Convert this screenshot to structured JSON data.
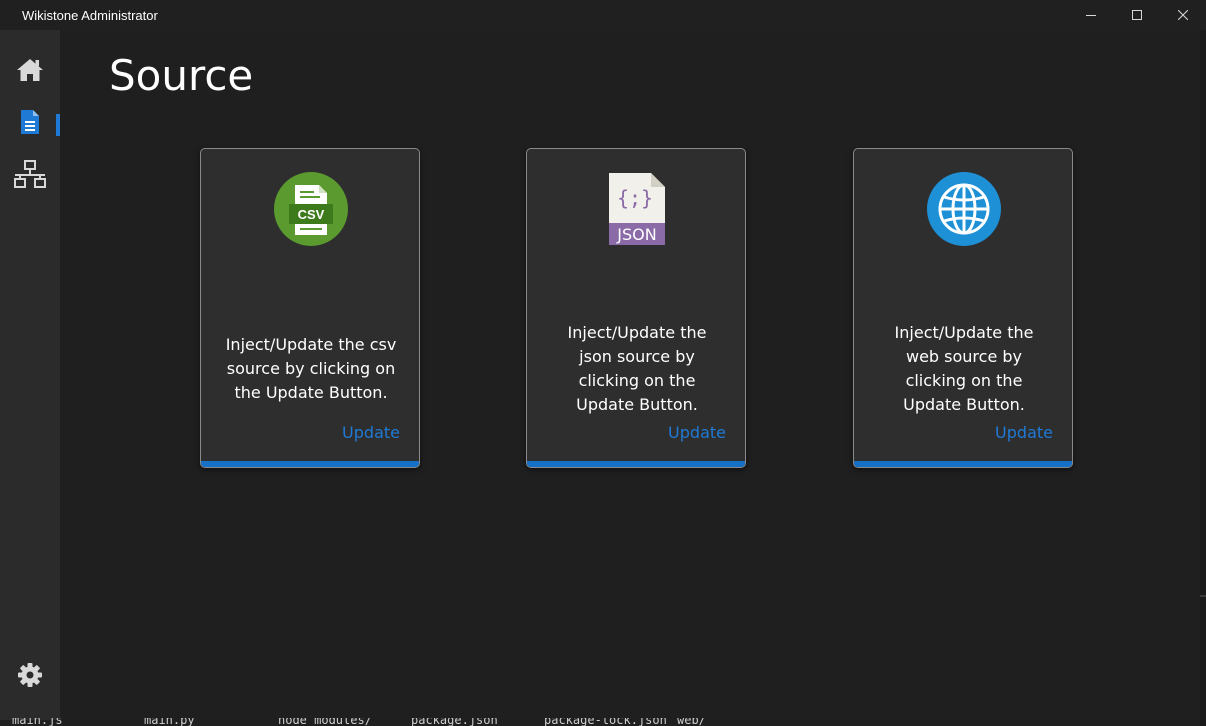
{
  "window": {
    "title": "Wikistone Administrator",
    "controls": [
      "minimize-icon",
      "maximize-icon",
      "close-icon"
    ]
  },
  "sidebar": {
    "items": [
      {
        "name": "home",
        "icon": "home-icon",
        "active": false
      },
      {
        "name": "source",
        "icon": "document-icon",
        "active": true
      },
      {
        "name": "network",
        "icon": "network-icon",
        "active": false
      }
    ],
    "bottom_item": {
      "name": "settings",
      "icon": "gear-icon"
    }
  },
  "page": {
    "title": "Source"
  },
  "cards": [
    {
      "icon": "csv-file-icon",
      "icon_label": "CSV",
      "description_lines": [
        "Inject/Update the csv",
        "source by clicking on",
        "the Update Button."
      ],
      "action_label": "Update"
    },
    {
      "icon": "json-file-icon",
      "icon_label": "JSON",
      "icon_glyph": "{;}",
      "description_lines": [
        "Inject/Update the",
        "json source by",
        "clicking on the",
        "Update Button."
      ],
      "action_label": "Update"
    },
    {
      "icon": "globe-icon",
      "description_lines": [
        "Inject/Update the",
        "web source by",
        "clicking on the",
        "Update Button."
      ],
      "action_label": "Update"
    }
  ],
  "colors": {
    "accent": "#1f7ad6",
    "background": "#1f1f1f",
    "sidebar": "#2b2b2b",
    "card": "#2e2e2e",
    "csv_green": "#5a9a2f",
    "json_purple": "#8b6aa8",
    "globe_blue": "#1e90d6"
  },
  "terminal_fragments": [
    "main.js",
    "main.py",
    "node_modules/",
    "package.json",
    "package-lock.json",
    "web/"
  ]
}
